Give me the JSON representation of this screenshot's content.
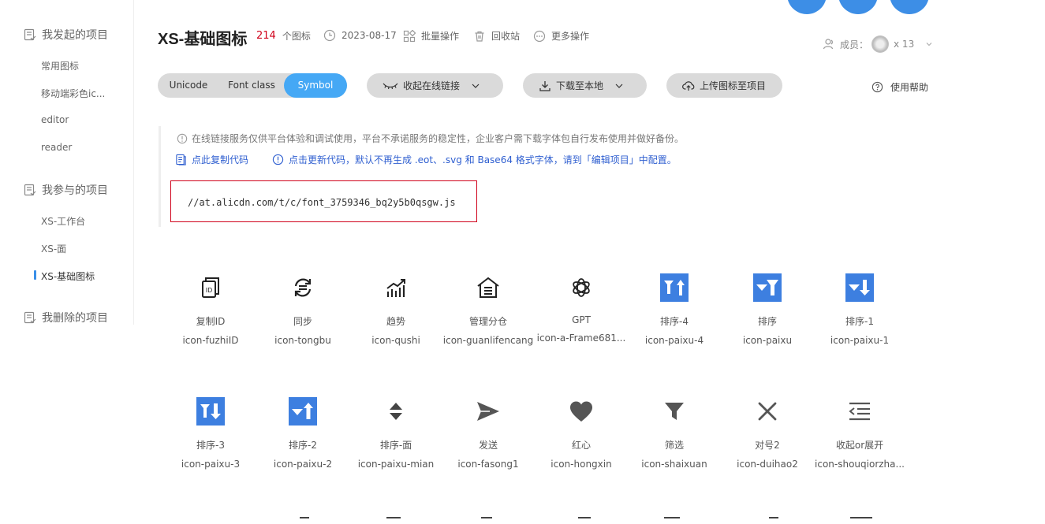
{
  "sidebar": {
    "sections": [
      {
        "title": "我发起的项目",
        "items": [
          "常用图标",
          "移动端彩色ic...",
          "editor",
          "reader"
        ]
      },
      {
        "title": "我参与的项目",
        "items": [
          "XS-工作台",
          "XS-面",
          "XS-基础图标"
        ]
      },
      {
        "title": "我删除的项目",
        "items": []
      }
    ],
    "active_item": "XS-基础图标"
  },
  "header": {
    "title": "XS-基础图标",
    "count": "214",
    "count_suffix": "个图标",
    "date": "2023-08-17",
    "batch": "批量操作",
    "recycle": "回收站",
    "more": "更多操作",
    "members_label": "成员：",
    "members_count": "x 13"
  },
  "toolbar": {
    "tabs": [
      "Unicode",
      "Font class",
      "Symbol"
    ],
    "active_tab": "Symbol",
    "collapse_link": "收起在线链接",
    "download": "下载至本地",
    "upload": "上传图标至项目",
    "help": "使用帮助"
  },
  "info": {
    "notice": "在线链接服务仅供平台体验和调试使用，平台不承诺服务的稳定性，企业客户需下载字体包自行发布使用并做好备份。",
    "copy_code": "点此复制代码",
    "update_code": "点击更新代码，默认不再生成 .eot、.svg 和 Base64 格式字体，请到「编辑项目」中配置。",
    "code_url": "//at.alicdn.com/t/c/font_3759346_bq2y5b0qsgw.js"
  },
  "icons": [
    {
      "name": "复制ID",
      "code": "icon-fuzhiID",
      "icon": "copy-id-icon"
    },
    {
      "name": "同步",
      "code": "icon-tongbu",
      "icon": "sync-icon"
    },
    {
      "name": "趋势",
      "code": "icon-qushi",
      "icon": "trend-icon"
    },
    {
      "name": "管理分仓",
      "code": "icon-guanlifencang",
      "icon": "warehouse-icon"
    },
    {
      "name": "GPT",
      "code": "icon-a-Frame681...",
      "icon": "gpt-icon"
    },
    {
      "name": "排序-4",
      "code": "icon-paixu-4",
      "icon": "sort-4-icon"
    },
    {
      "name": "排序",
      "code": "icon-paixu",
      "icon": "sort-icon"
    },
    {
      "name": "排序-1",
      "code": "icon-paixu-1",
      "icon": "sort-1-icon"
    },
    {
      "name": "排序-3",
      "code": "icon-paixu-3",
      "icon": "sort-3-icon"
    },
    {
      "name": "排序-2",
      "code": "icon-paixu-2",
      "icon": "sort-2-icon"
    },
    {
      "name": "排序-面",
      "code": "icon-paixu-mian",
      "icon": "sort-face-icon"
    },
    {
      "name": "发送",
      "code": "icon-fasong1",
      "icon": "send-icon"
    },
    {
      "name": "红心",
      "code": "icon-hongxin",
      "icon": "heart-icon"
    },
    {
      "name": "筛选",
      "code": "icon-shaixuan",
      "icon": "filter-icon"
    },
    {
      "name": "对号2",
      "code": "icon-duihao2",
      "icon": "close-x-icon"
    },
    {
      "name": "收起or展开",
      "code": "icon-shouqiorzha...",
      "icon": "collapse-expand-icon"
    }
  ],
  "colors": {
    "accent": "#45a8f5",
    "brand_blue": "#3d7fe0",
    "danger": "#d0021b"
  }
}
